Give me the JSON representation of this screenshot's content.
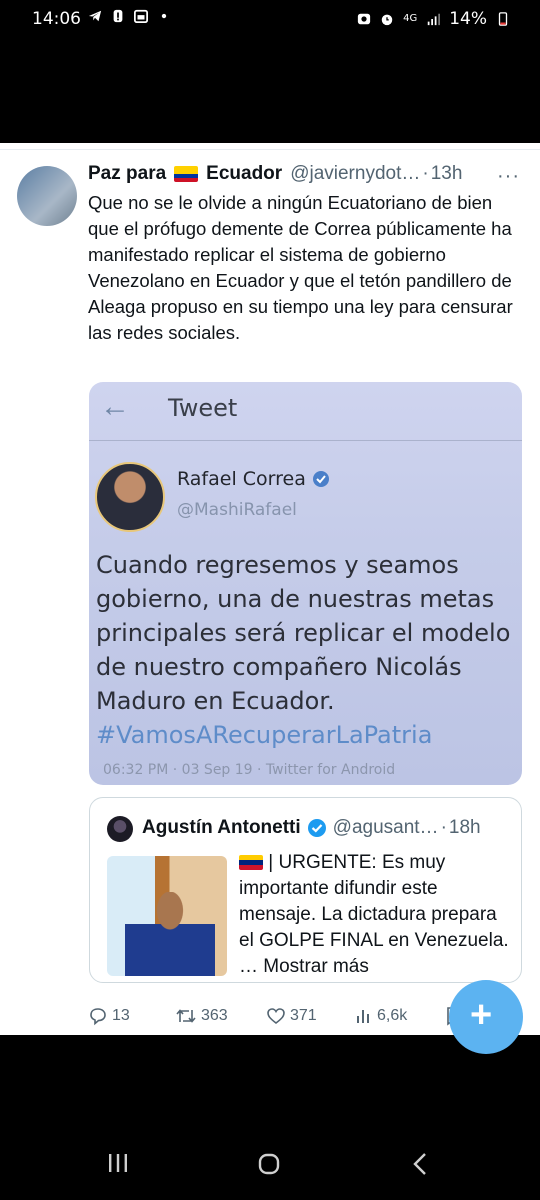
{
  "status_bar": {
    "time": "14:06",
    "battery": "14%",
    "network": "4G",
    "left_icons": [
      "telegram-icon",
      "alert-icon",
      "calendar-icon",
      "dot-icon"
    ],
    "right_icons": [
      "data-saver-icon",
      "alarm-icon",
      "network-4g-icon",
      "signal-icon",
      "battery-icon"
    ]
  },
  "tweet": {
    "author_name_prefix": "Paz para",
    "author_name_suffix": "Ecuador",
    "handle": "@javiernydot…",
    "separator": "·",
    "time": "13h",
    "text": "Que no se le olvide a ningún Ecuatoriano de bien que el prófugo demente de Correa públicamente ha manifestado replicar el sistema de gobierno Venezolano en Ecuador y que el tetón pandillero de Aleaga propuso en su tiempo una ley para censurar las redes sociales."
  },
  "embedded_image": {
    "title": "Tweet",
    "author_name": "Rafael Correa",
    "author_handle": "@MashiRafael",
    "body": "Cuando regresemos y seamos gobierno, una de nuestras metas principales será replicar el modelo de nuestro compañero Nicolás Maduro en Ecuador.",
    "hashtag": "#VamosARecuperarLaPatria",
    "footer": "06:32 PM · 03 Sep 19 · Twitter for Android"
  },
  "quoted_tweet": {
    "author_name": "Agustín Antonetti",
    "handle": "@agusant…",
    "separator": "·",
    "time": "18h",
    "text": "| URGENTE: Es muy importante difundir este mensaje. La dictadura prepara el GOLPE FINAL en Venezuela. …",
    "more_label": "Mostrar más"
  },
  "actions": {
    "replies": "13",
    "retweets": "363",
    "likes": "371",
    "views": "6,6k"
  },
  "colors": {
    "text": "#0f1419",
    "muted": "#536471",
    "verified": "#1d9bf0",
    "fab": "#5cb3f1"
  }
}
